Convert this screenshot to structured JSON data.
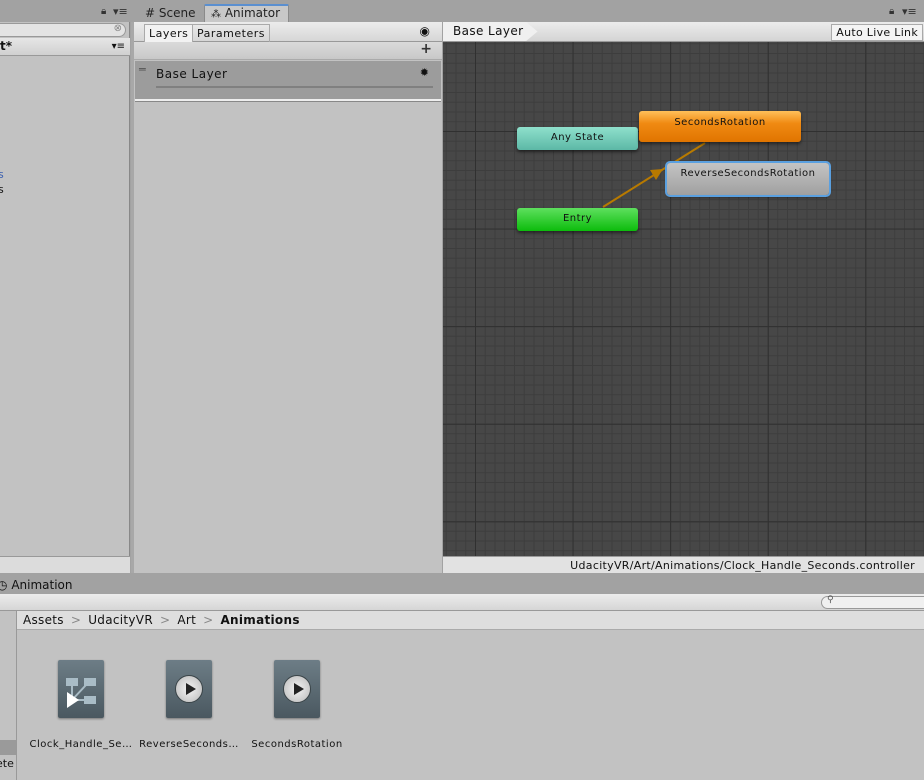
{
  "tabs": {
    "scene": "Scene",
    "animator": "Animator",
    "scene_icon": "grid-hash-icon",
    "animator_icon": "animator-icon"
  },
  "left_panel": {
    "header": "t*",
    "items": [
      "s",
      "s"
    ]
  },
  "layers_panel": {
    "tabs": [
      "Layers",
      "Parameters"
    ],
    "add_label": "+",
    "layers": [
      {
        "name": "Base Layer"
      }
    ]
  },
  "graph": {
    "breadcrumb": "Base Layer",
    "auto_live_link": "Auto Live Link",
    "path": "UdacityVR/Art/Animations/Clock_Handle_Seconds.controller",
    "states": [
      {
        "name": "Any State",
        "color": "#6fc9b6"
      },
      {
        "name": "SecondsRotation",
        "color": "#f08a12",
        "default": true
      },
      {
        "name": "ReverseSecondsRotation",
        "color": "#a9a9a9",
        "selected": true
      },
      {
        "name": "Entry",
        "color": "#22c122"
      }
    ],
    "transition_color": "#b87a00"
  },
  "animation_tab": {
    "label": "Animation"
  },
  "project": {
    "breadcrumb": [
      "Assets",
      "UdacityVR",
      "Art",
      "Animations"
    ],
    "left_label": "ete",
    "assets": [
      {
        "label": "Clock_Handle_Se…",
        "type": "animator-controller"
      },
      {
        "label": "ReverseSeconds…",
        "type": "animation-clip"
      },
      {
        "label": "SecondsRotation",
        "type": "animation-clip"
      }
    ]
  }
}
